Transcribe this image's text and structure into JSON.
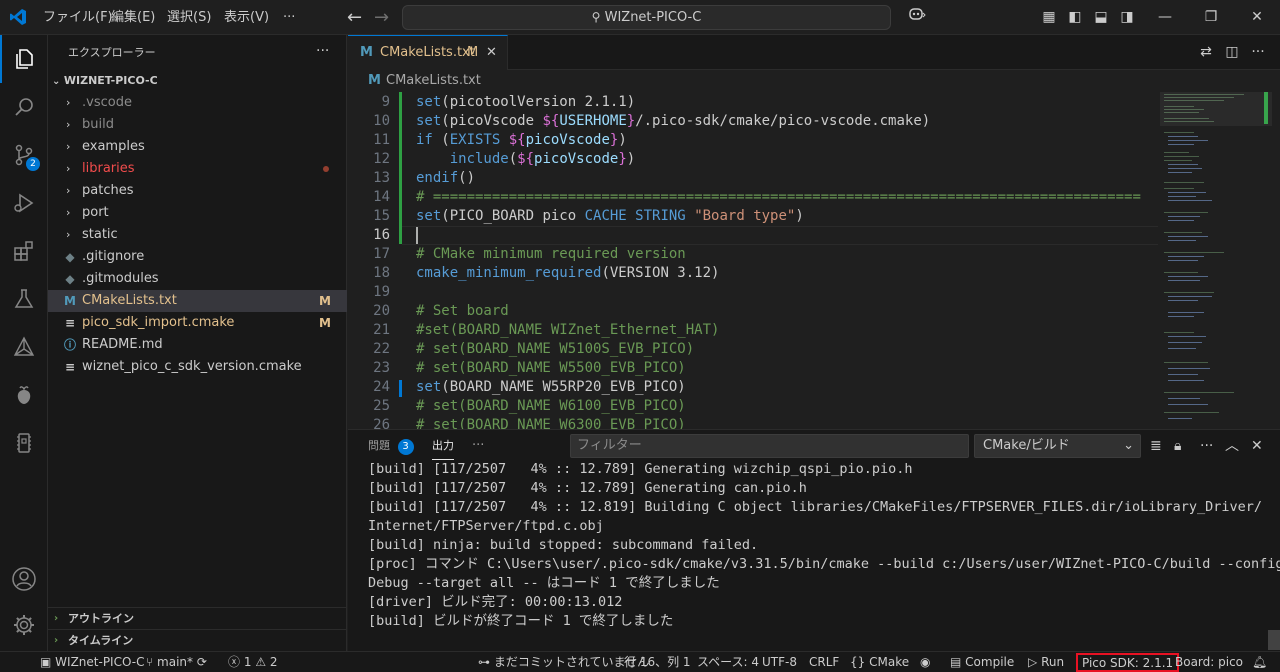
{
  "titlebar": {
    "menus": [
      "ファイル(F)",
      "編集(E)",
      "選択(S)",
      "表示(V)",
      "···"
    ],
    "search_text": "WIZnet-PICO-C",
    "back": "←",
    "forward": "→"
  },
  "activity": {
    "scm_badge": "2"
  },
  "sidebar": {
    "title": "エクスプローラー",
    "more": "···",
    "root": "WIZNET-PICO-C",
    "items": [
      {
        "name": ".vscode",
        "kind": "folder",
        "color": "#8b8b8b"
      },
      {
        "name": "build",
        "kind": "folder",
        "color": "#8b8b8b"
      },
      {
        "name": "examples",
        "kind": "folder",
        "color": "#cccccc"
      },
      {
        "name": "libraries",
        "kind": "folder",
        "color": "#f14c4c"
      },
      {
        "name": "patches",
        "kind": "folder",
        "color": "#cccccc"
      },
      {
        "name": "port",
        "kind": "folder",
        "color": "#cccccc"
      },
      {
        "name": "static",
        "kind": "folder",
        "color": "#cccccc"
      },
      {
        "name": ".gitignore",
        "kind": "file",
        "color": "#cccccc"
      },
      {
        "name": ".gitmodules",
        "kind": "file",
        "color": "#cccccc"
      },
      {
        "name": "CMakeLists.txt",
        "kind": "file",
        "color": "#e2c08d",
        "status": "M"
      },
      {
        "name": "pico_sdk_import.cmake",
        "kind": "file",
        "color": "#e2c08d",
        "status": "M"
      },
      {
        "name": "README.md",
        "kind": "file",
        "color": "#cccccc"
      },
      {
        "name": "wiznet_pico_c_sdk_version.cmake",
        "kind": "file",
        "color": "#cccccc"
      }
    ],
    "outline": "アウトライン",
    "timeline": "タイムライン"
  },
  "editor": {
    "tab_label": "CMakeLists.txt",
    "tab_status": "M",
    "breadcrumb": "CMakeLists.txt",
    "line_numbers": [
      "9",
      "10",
      "11",
      "12",
      "13",
      "14",
      "15",
      "16",
      "17",
      "18",
      "19",
      "20",
      "21",
      "22",
      "23",
      "24",
      "25",
      "26"
    ],
    "current_line": "16"
  },
  "panel": {
    "problems_label": "問題",
    "problems_count": "3",
    "output_label": "出力",
    "more": "···",
    "filter_placeholder": "フィルター",
    "channel": "CMake/ビルド",
    "lines": [
      "[build] [117/2507   4% :: 12.789] Generating wizchip_qspi_pio.pio.h",
      "[build] [117/2507   4% :: 12.789] Generating can.pio.h",
      "[build] [117/2507   4% :: 12.819] Building C object libraries/CMakeFiles/FTPSERVER_FILES.dir/ioLibrary_Driver/",
      "Internet/FTPServer/ftpd.c.obj",
      "[build] ninja: build stopped: subcommand failed.",
      "[proc] コマンド C:\\Users\\user/.pico-sdk/cmake/v3.31.5/bin/cmake --build c:/Users/user/WIZnet-PICO-C/build --config",
      "Debug --target all -- はコード 1 で終了しました",
      "[driver] ビルド完了: 00:00:13.012",
      "[build] ビルドが終了コード 1 で終了しました"
    ]
  },
  "statusbar": {
    "remote": "WIZnet-PICO-C",
    "branch": "main*",
    "errors": "1",
    "warnings": "2",
    "commit_msg": "まだコミットされていません",
    "position": "行 16、列 1",
    "spaces": "スペース: 4",
    "encoding": "UTF-8",
    "eol": "CRLF",
    "language": "CMake",
    "compile": "Compile",
    "run": "Run",
    "pico_sdk": "Pico SDK: 2.1.1",
    "board": "Board: pico",
    "highlight_color": "#e81123"
  }
}
